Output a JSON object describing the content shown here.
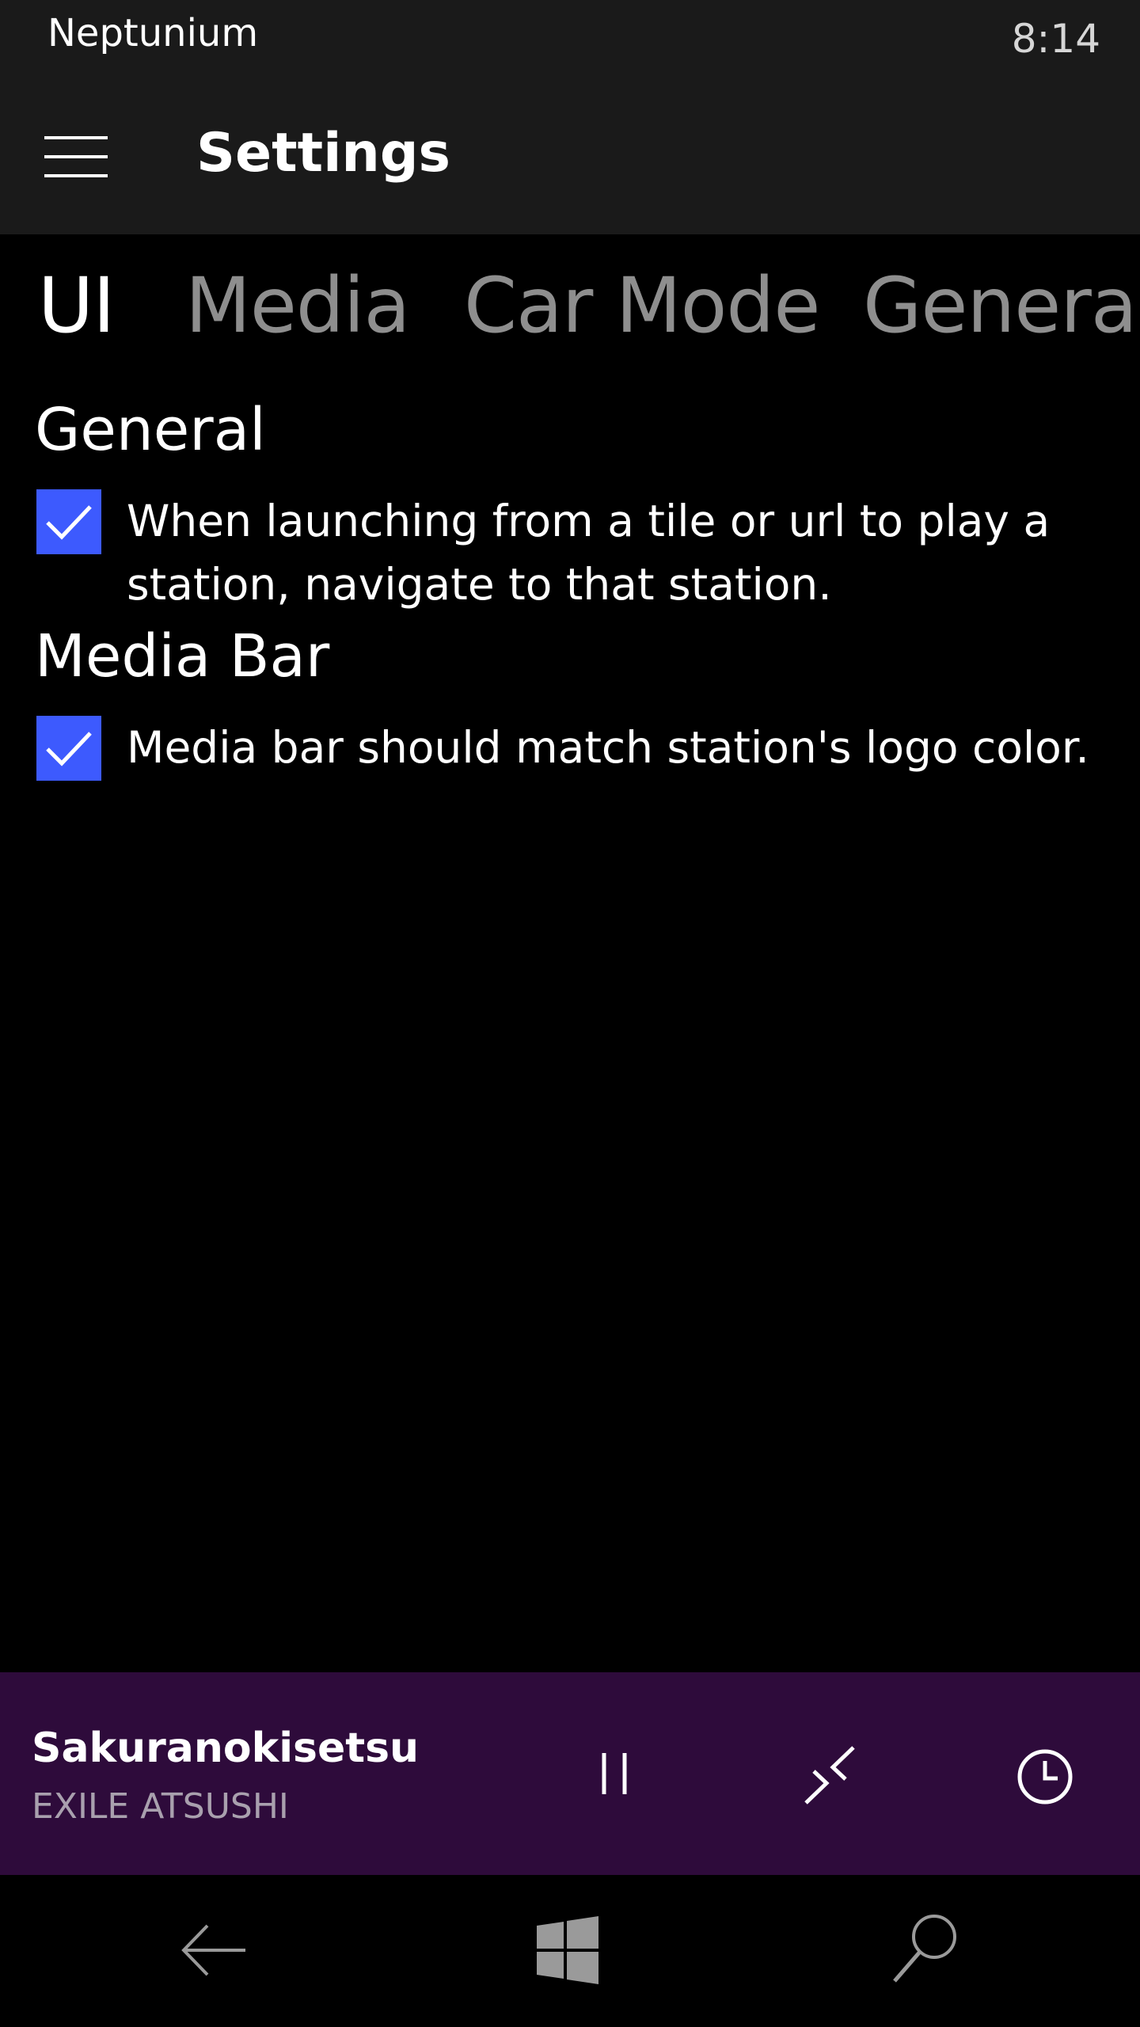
{
  "status_bar": {
    "app_name": "Neptunium",
    "time": "8:14"
  },
  "header": {
    "title": "Settings",
    "menu_icon": "hamburger-icon"
  },
  "tabs": [
    {
      "label": "UI",
      "active": true
    },
    {
      "label": "Media",
      "active": false
    },
    {
      "label": "Car Mode",
      "active": false
    },
    {
      "label": "General",
      "active": false
    }
  ],
  "sections": [
    {
      "heading": "General",
      "settings": [
        {
          "label": "When launching from a tile or url to play a station, navigate to that station.",
          "checked": true
        }
      ]
    },
    {
      "heading": "Media Bar",
      "settings": [
        {
          "label": "Media bar should match station's logo color.",
          "checked": true
        }
      ]
    }
  ],
  "media_bar": {
    "track_title": "Sakuranokisetsu",
    "artist": "EXILE ATSUSHI",
    "background_color": "#2e0b3b",
    "controls": [
      "pause-icon",
      "collapse-icon",
      "history-icon"
    ]
  },
  "nav_bar": {
    "buttons": [
      "back-arrow-icon",
      "windows-logo-icon",
      "search-icon"
    ]
  },
  "colors": {
    "accent": "#3d5afe",
    "header_bg": "#1a1a1a",
    "inactive_tab": "#8e8e8e"
  }
}
